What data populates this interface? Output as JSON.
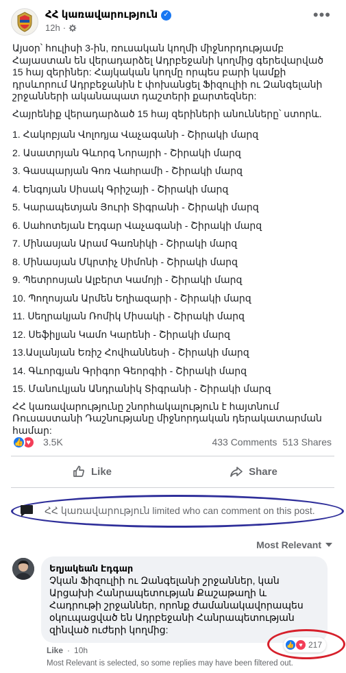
{
  "post": {
    "page_name": "ՀՀ կառավարություն",
    "time": "12h",
    "paragraph_1": "Այսօր՝ հուլիսի 3-ին, ռուսական կողմի միջնորդությամբ Հայաստան են վերադարձել Ադրբեջանի կողմից գերեվարված 15 հայ զերիներ: Հայկական կողմը որպես բարի կամքի դրսևորում Ադրբեջանին է փոխանցել Ֆիզուլիի ու Զանգելանի շրջանների ականապատ դաշտերի քարտեզներ:",
    "paragraph_2": "Հայրենիք վերադարձած 15 հայ զերիների անունները՝ ստորև.",
    "names": [
      "1. Հակոբյան Վոլոդյա Վաչագանի - Շիրակի մարզ",
      "2. Ասատրյան Գևորգ Նորայրի - Շիրակի մարզ",
      "3. Գասպարյան Գոռ Վաhրամի - Շիրակի մարզ",
      "4. Ենգոյան Սիսակ Գրիշայի - Շիրակի մարզ",
      "5. Կարապետյան Յուրի Տիգրանի - Շիրակի մարզ",
      "6. Սահոտեյան Էդգար Վաչագանի - Շիրակի մարզ",
      "7. Մինասյան Արամ Գառնիկի - Շիրակի մարզ",
      "8. Մինասյան Մկրտիչ Սիմոնի - Շիրակի մարզ",
      "9. Պետրոսյան Ալբերտ Կամոյի - Շիրակի մարզ",
      "10. Պողոսյան Արմեն Եղիազարի - Շիրակի մարզ",
      "11. Սեղրակյան Ռոմիկ Միսակի - Շիրակի մարզ",
      "12. Սեֆիլյան Կամո Կարենի - Շիրակի մարզ",
      "13.Ասլանյան Եռիշ Հովհաննեսի - Շիրակի մարզ",
      "14. Գևորգյան Գրիգոր Գեորգիի - Շիրակի մարզ",
      "15. Մանուկյան Անդրանիկ Տիգրանի - Շիրակի մարզ"
    ],
    "closing": "ՀՀ կառավարությունը շնորհակալություն է հայտնում Ռուսաստանի Դաշնությանը միջնորդական դերակատարման համար:"
  },
  "reactions": {
    "count": "3.5K",
    "comments": "433 Comments",
    "shares": "513 Shares"
  },
  "actions": {
    "like": "Like",
    "share": "Share"
  },
  "limited_notice": "ՀՀ կառավարություն limited who can comment on this post.",
  "sort_label": "Most Relevant",
  "comment": {
    "author": "Եղյակեան Էդգար",
    "text": "Չկան Ֆիզուլիի ու Զանգելանի շրջաններ, կան Արցախի Հանրապետության Քաշաթաղի և Հադրութի շրջաններ, որոնք ժամանակավորապես օկուպացված են Ադրբեջանի Հանրապետության զինված ուժերի կողմից:",
    "like_label": "Like",
    "time": "10h",
    "reaction_count": "217"
  },
  "filter_note": "Most Relevant is selected, so some replies may have been filtered out.",
  "colors": {
    "accent": "#1877f2",
    "love": "#f33e58",
    "blue_annotation": "#2f2f9a",
    "red_annotation": "#d6202b"
  }
}
